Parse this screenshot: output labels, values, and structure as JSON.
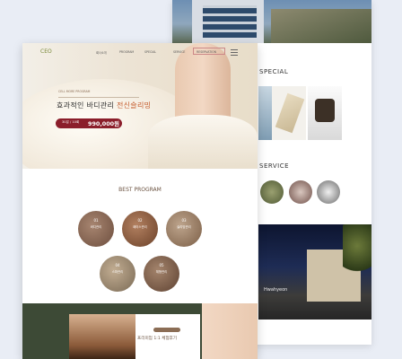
{
  "back": {
    "special_title": "SPECIAL",
    "service_title": "SERVICE",
    "night_caption": "Hwahyeon"
  },
  "front": {
    "logo": "CEO",
    "nav": [
      "회사소개",
      "PROGRAM",
      "SPECIAL",
      "SERVICE",
      "RESERVATION"
    ],
    "hero": {
      "subtitle": "CELL MORE PROGRAM",
      "title_prefix": "효과적인 바디관리 ",
      "title_highlight": "전신슬리밍",
      "price_label": "30분 / 10회",
      "price_value": "990,000원"
    },
    "best": {
      "title": "BEST PROGRAM",
      "items": [
        {
          "num": "01",
          "label": "바디관리"
        },
        {
          "num": "02",
          "label": "페이스관리"
        },
        {
          "num": "03",
          "label": "슬리밍관리"
        },
        {
          "num": "04",
          "label": "스파관리"
        },
        {
          "num": "05",
          "label": "체형관리"
        }
      ]
    },
    "bottom": {
      "title": "프리미엄 1:1 체험후기"
    }
  },
  "colors": {
    "accent": "#8b1e2b",
    "brand_brown": "#6b5240",
    "dark_green": "#3d4a36"
  }
}
